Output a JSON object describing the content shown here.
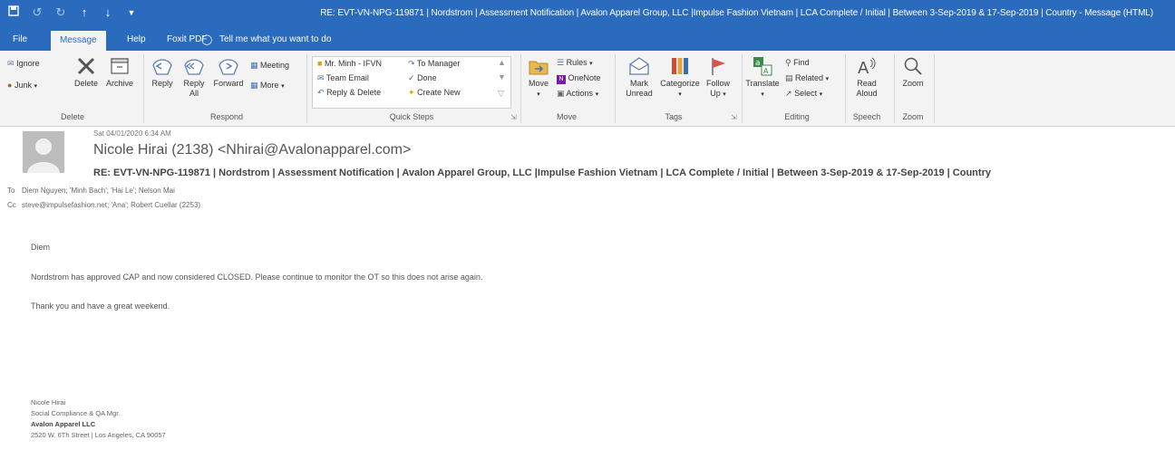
{
  "window": {
    "title": "RE: EVT-VN-NPG-119871 | Nordstrom | Assessment Notification | Avalon Apparel Group, LLC |Impulse Fashion Vietnam | LCA Complete / Initial | Between 3-Sep-2019 & 17-Sep-2019 | Country  -  Message (HTML)",
    "qat_icons": [
      "save-icon",
      "undo-icon",
      "redo-icon",
      "up-arrow-icon",
      "down-arrow-icon",
      "customize-icon"
    ]
  },
  "tabs": {
    "file": "File",
    "message": "Message",
    "help": "Help",
    "foxit": "Foxit PDF",
    "tell_me": "Tell me what you want to do"
  },
  "ribbon": {
    "delete_group": {
      "ignore": "Ignore",
      "junk": "Junk",
      "delete": "Delete",
      "archive": "Archive",
      "label": "Delete"
    },
    "respond_group": {
      "reply": "Reply",
      "reply_all_1": "Reply",
      "reply_all_2": "All",
      "forward": "Forward",
      "meeting": "Meeting",
      "more": "More",
      "label": "Respond"
    },
    "quick_steps": {
      "item1": "Mr. Minh - IFVN",
      "item2": "Team Email",
      "item3": "Reply & Delete",
      "item4": "To Manager",
      "item5": "Done",
      "item6": "Create New",
      "label": "Quick Steps"
    },
    "move_group": {
      "move": "Move",
      "rules": "Rules",
      "onenote": "OneNote",
      "actions": "Actions",
      "label": "Move"
    },
    "tags_group": {
      "mark_unread_1": "Mark",
      "mark_unread_2": "Unread",
      "categorize": "Categorize",
      "follow_up_1": "Follow",
      "follow_up_2": "Up",
      "label": "Tags"
    },
    "editing_group": {
      "translate": "Translate",
      "find": "Find",
      "related": "Related",
      "select": "Select",
      "label": "Editing"
    },
    "speech_group": {
      "read_aloud_1": "Read",
      "read_aloud_2": "Aloud",
      "label": "Speech"
    },
    "zoom_group": {
      "zoom": "Zoom",
      "label": "Zoom"
    }
  },
  "message": {
    "date": "Sat 04/01/2020 6:34 AM",
    "sender": "Nicole Hirai (2138) <Nhirai@Avalonapparel.com>",
    "subject": "RE: EVT-VN-NPG-119871 | Nordstrom | Assessment Notification | Avalon Apparel Group, LLC |Impulse Fashion Vietnam | LCA Complete / Initial | Between 3-Sep-2019 & 17-Sep-2019 | Country",
    "to_label": "To",
    "to": "Diem Nguyen; 'Minh Bach'; 'Hai Le'; Nelson Mai",
    "cc_label": "Cc",
    "cc": "steve@impulsefashion.net; 'Ana'; Robert Cuellar (2253)",
    "body": {
      "greeting": "Diem",
      "line1": "Nordstrom has approved CAP and now considered CLOSED.  Please continue to monitor the OT so this does not arise again.",
      "line2": "Thank you and have a great weekend."
    },
    "signature": {
      "name": "Nicole Hirai",
      "title": "Social Compliance & QA Mgr.",
      "company": "Avalon Apparel LLC",
      "address": "2520 W. 6Th Street | Los Angeles, CA 90057"
    }
  },
  "colors": {
    "titlebar": "#2b6bbd",
    "ribbon_bg": "#f3f3f3",
    "accent_blue": "#2b6bbd"
  }
}
